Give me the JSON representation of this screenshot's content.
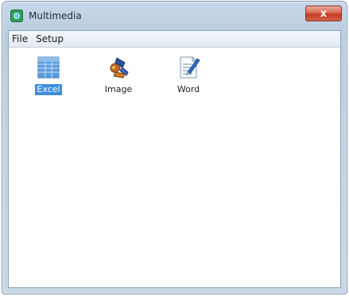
{
  "window": {
    "title": "Multimedia",
    "close_glyph": "x"
  },
  "menubar": {
    "items": [
      {
        "label": "File"
      },
      {
        "label": "Setup"
      }
    ]
  },
  "icons": [
    {
      "label": "Excel",
      "icon": "excel-spreadsheet-icon",
      "selected": true
    },
    {
      "label": "Image",
      "icon": "image-paint-icon",
      "selected": false
    },
    {
      "label": "Word",
      "icon": "word-document-icon",
      "selected": false
    }
  ],
  "colors": {
    "selection": "#3d8ee0",
    "close_button": "#d6614a",
    "frame": "#c2d3e3"
  }
}
